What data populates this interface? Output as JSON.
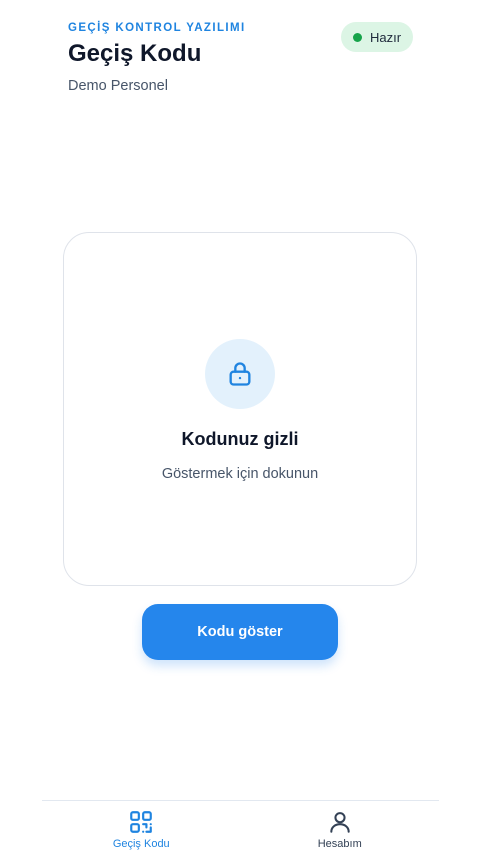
{
  "header": {
    "app_label": "GEÇİŞ KONTROL YAZILIMI",
    "title": "Geçiş Kodu",
    "subtitle": "Demo Personel"
  },
  "status": {
    "label": "Hazır",
    "color": "#16a34a"
  },
  "code_card": {
    "icon": "lock-icon",
    "title": "Kodunuz gizli",
    "hint": "Göstermek için dokunun"
  },
  "actions": {
    "show_code": "Kodu göster"
  },
  "bottom_nav": {
    "items": [
      {
        "label": "Geçiş Kodu",
        "icon": "qr-code-icon",
        "active": true
      },
      {
        "label": "Hesabım",
        "icon": "user-icon",
        "active": false
      }
    ]
  },
  "colors": {
    "accent": "#1f84e0",
    "button": "#2586ec",
    "status_bg": "#dcf5e5"
  }
}
